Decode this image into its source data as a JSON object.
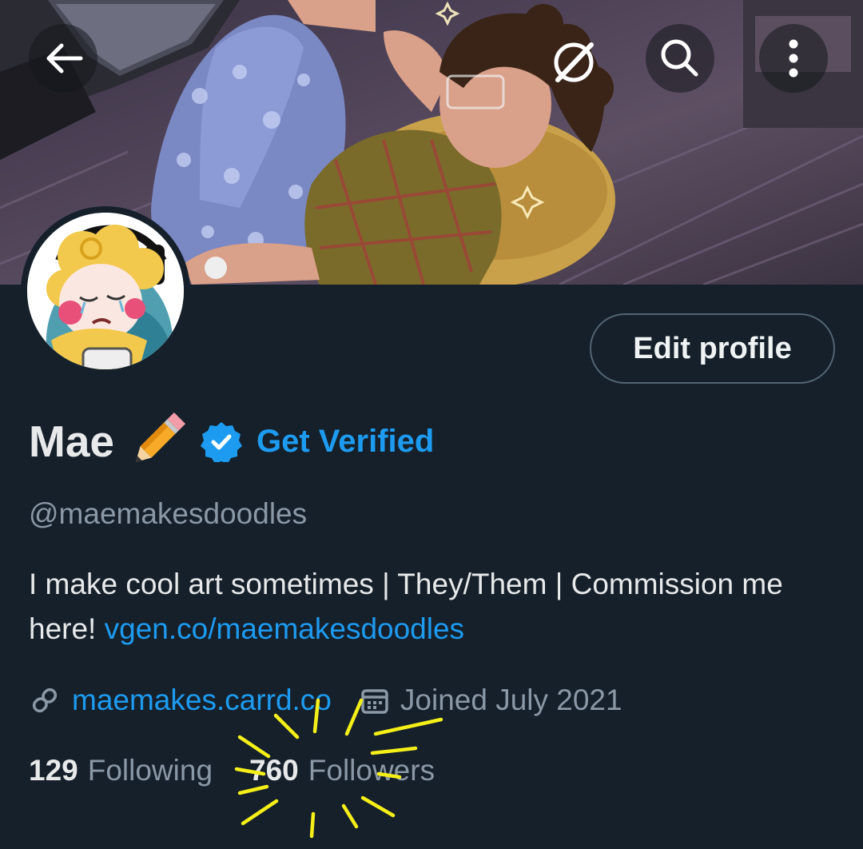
{
  "header": {
    "back_icon": "arrow-left-icon",
    "no_color_icon": "slashed-circle-icon",
    "search_icon": "search-icon",
    "more_icon": "vertical-dots-icon"
  },
  "profile": {
    "name": "Mae",
    "name_emoji": "pencil-icon",
    "verified_badge_icon": "verified-badge-icon",
    "get_verified_label": "Get Verified",
    "handle": "@maemakesdoodles",
    "edit_profile_label": "Edit profile",
    "bio_text": "I make cool art sometimes | They/Them | Commission me here!",
    "bio_link": "vgen.co/maemakesdoodles",
    "website": "maemakes.carrd.co",
    "joined": "Joined July 2021",
    "following_count": "129",
    "following_label": "Following",
    "followers_count": "760",
    "followers_label": "Followers"
  },
  "colors": {
    "background": "#15202b",
    "accent": "#1d9bf0",
    "secondary_text": "#8b98a5",
    "highlight_doodle": "#f5ef18"
  }
}
